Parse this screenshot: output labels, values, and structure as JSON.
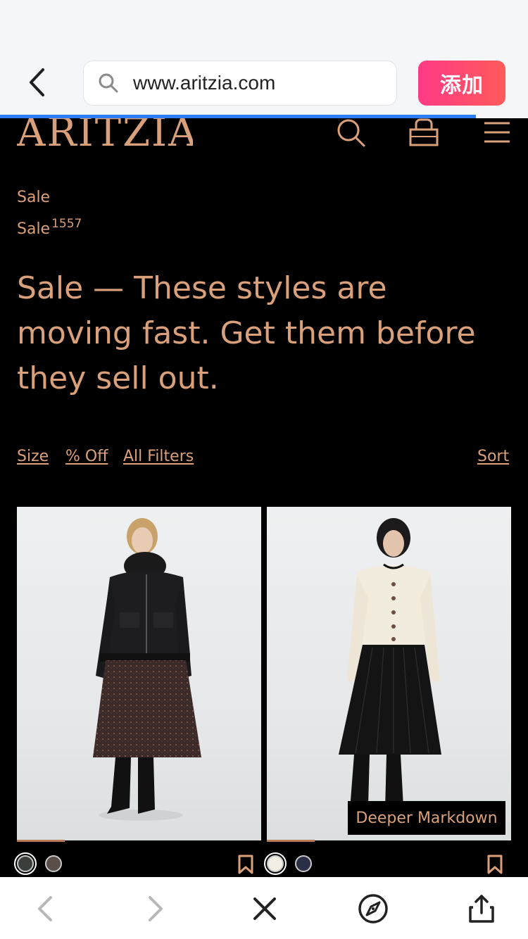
{
  "browser": {
    "url": "www.aritzia.com",
    "add_label": "添加"
  },
  "site": {
    "logo": "ARITZIA"
  },
  "breadcrumb": {
    "parent": "Sale",
    "current": "Sale",
    "count": "1557"
  },
  "headline": "Sale — These styles are moving fast. Get them before they sell out.",
  "filters": {
    "size": "Size",
    "percent_off": "% Off",
    "all_filters": "All Filters",
    "sort": "Sort"
  },
  "products": [
    {
      "swatches": [
        "#3a3f3b",
        "#5a4f48"
      ]
    },
    {
      "badge": "Deeper Markdown",
      "swatches": [
        "#f2eee4",
        "#2a2f45"
      ]
    }
  ],
  "icons": {
    "back": "chevron-left-icon",
    "search": "search-icon",
    "bag": "shopping-bag-icon",
    "menu": "hamburger-menu-icon",
    "bookmark": "bookmark-icon",
    "forward": "chevron-right-icon",
    "close": "close-icon",
    "compass": "compass-icon",
    "share": "share-icon"
  },
  "colors": {
    "accent": "#d9a07a",
    "add_button": "#ff3a86",
    "progress": "#2d7cf6"
  }
}
